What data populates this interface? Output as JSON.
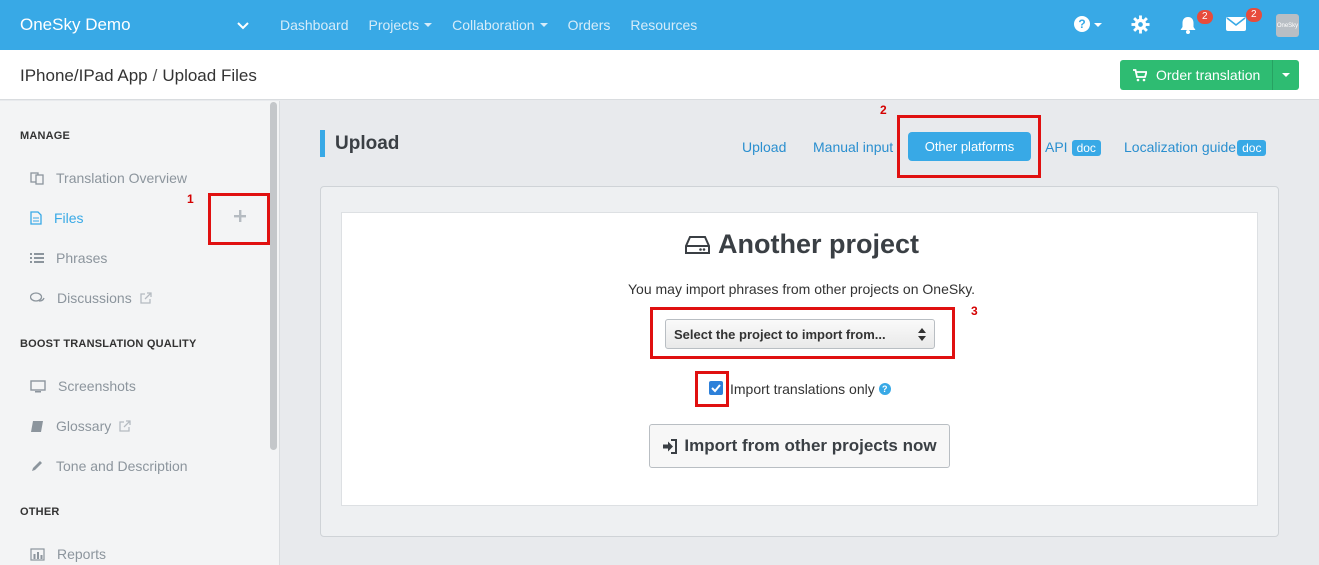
{
  "topbar": {
    "brand": "OneSky Demo",
    "nav": [
      {
        "label": "Dashboard",
        "dropdown": false
      },
      {
        "label": "Projects",
        "dropdown": true
      },
      {
        "label": "Collaboration",
        "dropdown": true
      },
      {
        "label": "Orders",
        "dropdown": false
      },
      {
        "label": "Resources",
        "dropdown": false
      }
    ],
    "notifications_count": "2",
    "messages_count": "2",
    "avatar_text": "OneSky"
  },
  "subheader": {
    "project": "IPhone/IPad App",
    "separator": "/",
    "page": "Upload Files",
    "order_button": "Order translation"
  },
  "sidebar": {
    "sections": [
      {
        "heading": "MANAGE"
      },
      {
        "heading": "BOOST TRANSLATION QUALITY"
      },
      {
        "heading": "OTHER"
      }
    ],
    "items": [
      {
        "label": "Translation Overview"
      },
      {
        "label": "Files"
      },
      {
        "label": "Phrases"
      },
      {
        "label": "Discussions"
      },
      {
        "label": "Screenshots"
      },
      {
        "label": "Glossary"
      },
      {
        "label": "Tone and Description"
      },
      {
        "label": "Reports"
      }
    ]
  },
  "main": {
    "title": "Upload",
    "tabs": {
      "upload": "Upload",
      "manual": "Manual input",
      "other": "Other platforms",
      "api": "API",
      "guide": "Localization guide",
      "doc": "doc"
    },
    "panel": {
      "title": "Another project",
      "description": "You may import phrases from other projects on OneSky.",
      "select_placeholder": "Select the project to import from...",
      "checkbox_label": "Import translations only",
      "checkbox_checked": true,
      "help": "?",
      "import_button": "Import from other projects now"
    }
  },
  "annotations": {
    "n1": "1",
    "n2": "2",
    "n3": "3"
  },
  "colors": {
    "primary": "#38a9e6",
    "success": "#2ebc72",
    "annotation": "#e01010"
  }
}
